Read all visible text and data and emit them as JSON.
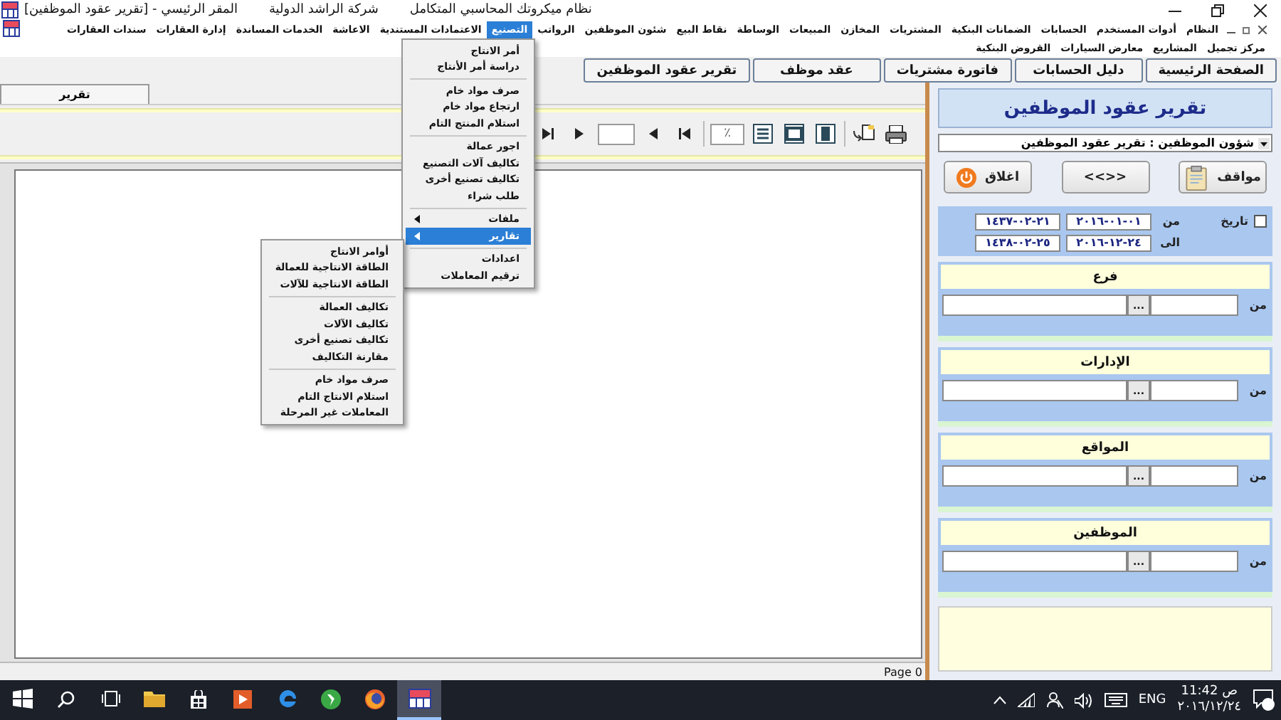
{
  "window": {
    "title_parts": [
      "نظام ميكروتك المحاسبي المتكامل",
      "شركة الراشد الدولية",
      "المقر الرئيسي - [تقرير عقود الموظفين]"
    ]
  },
  "menu_bar": {
    "rows": [
      [
        {
          "label": "النظام",
          "selected": false
        },
        {
          "label": "أدوات المستخدم",
          "selected": false
        },
        {
          "label": "الحسابات",
          "selected": false
        },
        {
          "label": "الضمانات البنكية",
          "selected": false
        },
        {
          "label": "المشتريات",
          "selected": false
        },
        {
          "label": "المخازن",
          "selected": false
        },
        {
          "label": "المبيعات",
          "selected": false
        },
        {
          "label": "الوساطة",
          "selected": false
        },
        {
          "label": "نقاط البيع",
          "selected": false
        },
        {
          "label": "شئون الموظفين",
          "selected": false
        },
        {
          "label": "الرواتب",
          "selected": false
        },
        {
          "label": "التصنيع",
          "selected": true
        },
        {
          "label": "الاعتمادات المستندية",
          "selected": false
        },
        {
          "label": "الاعاشة",
          "selected": false
        },
        {
          "label": "الخدمات المساندة",
          "selected": false
        },
        {
          "label": "إدارة العقارات",
          "selected": false
        },
        {
          "label": "سندات العقارات",
          "selected": false
        }
      ],
      [
        {
          "label": "مركز تجميل",
          "selected": false
        },
        {
          "label": "المشاريع",
          "selected": false
        },
        {
          "label": "معارض السيارات",
          "selected": false
        },
        {
          "label": "القروض البنكية",
          "selected": false
        }
      ]
    ]
  },
  "quick_tabs": [
    {
      "label": "الصفحة الرئيسية"
    },
    {
      "label": "دليل الحسابات"
    },
    {
      "label": "فاتورة مشتريات"
    },
    {
      "label": "عقد موظف"
    },
    {
      "label": "تقرير عقود الموظفين"
    }
  ],
  "report_viewer": {
    "tab": "تقرير",
    "zoom_value": "٪",
    "status": "Page 0"
  },
  "manufacturing_menu": {
    "items": [
      {
        "kind": "item",
        "label": "أمر الانتاج",
        "selected": false
      },
      {
        "kind": "item",
        "label": "دراسة أمر الأنتاج",
        "selected": false
      },
      {
        "kind": "separator"
      },
      {
        "kind": "item",
        "label": "صرف مواد خام",
        "selected": false
      },
      {
        "kind": "item",
        "label": "ارتجاع مواد خام",
        "selected": false
      },
      {
        "kind": "item",
        "label": "استلام المنتج التام",
        "selected": false
      },
      {
        "kind": "separator"
      },
      {
        "kind": "item",
        "label": "اجور عمالة",
        "selected": false
      },
      {
        "kind": "item",
        "label": "تكاليف آلات التصنيع",
        "selected": false
      },
      {
        "kind": "item",
        "label": "تكاليف تصنيع أخرى",
        "selected": false
      },
      {
        "kind": "item",
        "label": "طلب شراء",
        "selected": false
      },
      {
        "kind": "separator"
      },
      {
        "kind": "submenu",
        "label": "ملفات",
        "selected": false
      },
      {
        "kind": "submenu",
        "label": "تقارير",
        "selected": true
      },
      {
        "kind": "separator"
      },
      {
        "kind": "item",
        "label": "اعدادات",
        "selected": false
      },
      {
        "kind": "item",
        "label": "ترقيم المعاملات",
        "selected": false
      }
    ]
  },
  "reports_submenu": {
    "items": [
      {
        "kind": "item",
        "label": "أوامر الانتاج",
        "selected": false
      },
      {
        "kind": "item",
        "label": "الطاقة الانتاجية للعمالة",
        "selected": false
      },
      {
        "kind": "item",
        "label": "الطاقة الانتاجية للآلات",
        "selected": false
      },
      {
        "kind": "separator"
      },
      {
        "kind": "item",
        "label": "تكاليف العمالة",
        "selected": false
      },
      {
        "kind": "item",
        "label": "تكاليف الآلات",
        "selected": false
      },
      {
        "kind": "item",
        "label": "تكاليف تصنيع أخرى",
        "selected": false
      },
      {
        "kind": "item",
        "label": "مقارنة التكاليف",
        "selected": false
      },
      {
        "kind": "separator"
      },
      {
        "kind": "item",
        "label": "صرف مواد خام",
        "selected": false
      },
      {
        "kind": "item",
        "label": "استلام الانتاج التام",
        "selected": false
      },
      {
        "kind": "item",
        "label": "المعاملات غير المرحلة",
        "selected": false
      }
    ]
  },
  "side_panel": {
    "title": "تقرير عقود الموظفين",
    "report_select": "شؤون الموظفين : تقرير عقود الموظفين",
    "buttons": [
      {
        "kind": "clipboard",
        "label": "مواقف"
      },
      {
        "kind": "text",
        "label": "<<>>"
      },
      {
        "kind": "power",
        "label": "اغلاق"
      }
    ],
    "date_filter": {
      "label": "تاريخ",
      "checked": false,
      "from_label": "من",
      "to_label": "الى",
      "from_gregorian": "٠١-٠١-٢٠١٦",
      "from_hijri": "٢١-٠٢-١٤٣٧",
      "to_gregorian": "٢٤-١٢-٢٠١٦",
      "to_hijri": "٢٥-٠٢-١٤٣٨"
    },
    "groups": [
      {
        "title": "فرع",
        "from_label": "من",
        "browse": "..."
      },
      {
        "title": "الإدارات",
        "from_label": "من",
        "browse": "..."
      },
      {
        "title": "المواقع",
        "from_label": "من",
        "browse": "..."
      },
      {
        "title": "الموظفين",
        "from_label": "من",
        "browse": "..."
      }
    ]
  },
  "taskbar": {
    "apps": [
      {
        "kind": "start",
        "active": false
      },
      {
        "kind": "search",
        "active": false
      },
      {
        "kind": "task-view",
        "active": false
      },
      {
        "kind": "folder",
        "active": false
      },
      {
        "kind": "store",
        "active": false
      },
      {
        "kind": "media",
        "active": false
      },
      {
        "kind": "edge",
        "active": false
      },
      {
        "kind": "green",
        "active": false
      },
      {
        "kind": "firefox",
        "active": false
      },
      {
        "kind": "app",
        "active": true
      }
    ],
    "language": "ENG",
    "time": "11:42 ص",
    "date": "٢٠١٦/١٢/٢٤"
  }
}
